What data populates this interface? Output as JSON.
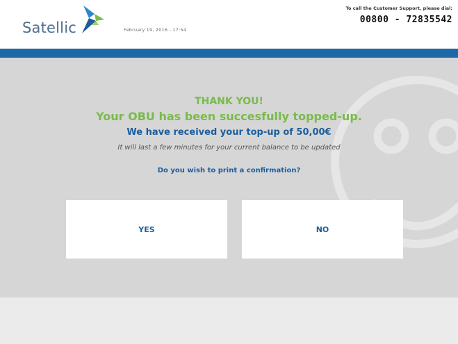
{
  "header": {
    "brand_name": "Satellic",
    "datetime": "February 19, 2016 - 17:54",
    "support_label": "To call the Customer Support, please dial:",
    "support_number": "00800 - 72835542"
  },
  "main": {
    "thank_you": "THANK YOU!",
    "topped_up": "Your OBU has been succesfully topped-up.",
    "received": "We have received your top-up of 50,00€",
    "info": "It will last a few minutes for your current balance to be updated",
    "question": "Do you wish to print a confirmation?",
    "yes_label": "YES",
    "no_label": "NO"
  },
  "icons": [
    "satellic-logo-icon",
    "smiley-watermark-icon"
  ],
  "colors": {
    "accent_blue": "#1f68a8",
    "text_blue": "#1b5e9e",
    "success_green": "#79bb4a",
    "panel_gray": "#d6d6d6",
    "footer_gray": "#ebebeb"
  }
}
